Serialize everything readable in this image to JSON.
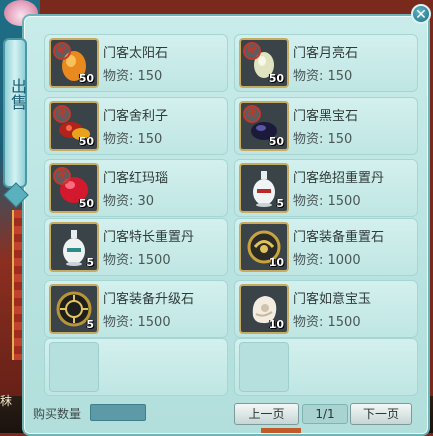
{
  "window": {
    "tab_label": "出售",
    "close_symbol": "✕"
  },
  "items": [
    {
      "name": "门客太阳石",
      "price": "物资: 150",
      "qty": "50",
      "icon": "sun-stone-icon",
      "seal": "秘"
    },
    {
      "name": "门客月亮石",
      "price": "物资: 150",
      "qty": "50",
      "icon": "moon-stone-icon",
      "seal": "秘"
    },
    {
      "name": "门客舍利子",
      "price": "物资: 150",
      "qty": "50",
      "icon": "sarira-icon",
      "seal": "秘"
    },
    {
      "name": "门客黑宝石",
      "price": "物资: 150",
      "qty": "50",
      "icon": "black-gem-icon",
      "seal": "秘"
    },
    {
      "name": "门客红玛瑙",
      "price": "物资: 30",
      "qty": "50",
      "icon": "red-agate-icon",
      "seal": "秘"
    },
    {
      "name": "门客绝招重置丹",
      "price": "物资: 1500",
      "qty": "5",
      "icon": "vase-icon",
      "seal": ""
    },
    {
      "name": "门客特长重置丹",
      "price": "物资: 1500",
      "qty": "5",
      "icon": "vase-icon",
      "seal": ""
    },
    {
      "name": "门客装备重置石",
      "price": "物资: 1000",
      "qty": "10",
      "icon": "rune-stone-icon",
      "seal": ""
    },
    {
      "name": "门客装备升级石",
      "price": "物资: 1500",
      "qty": "5",
      "icon": "rune-disc-icon",
      "seal": ""
    },
    {
      "name": "门客如意宝玉",
      "price": "物资: 1500",
      "qty": "10",
      "icon": "jade-icon",
      "seal": ""
    }
  ],
  "footer": {
    "quantity_label": "购买数量",
    "prev_label": "上一页",
    "page_indicator": "1/1",
    "next_label": "下一页"
  },
  "background": {
    "corner_text": "秣"
  }
}
